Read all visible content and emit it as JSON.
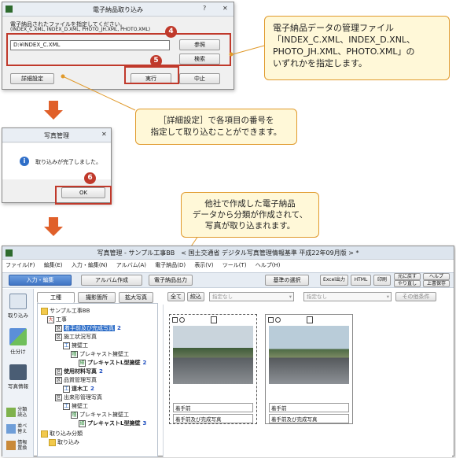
{
  "import_dialog": {
    "title": "電子納品取り込み",
    "instruction_line1": "電子納品されたファイルを指定してください。",
    "instruction_line2": "(INDEX_C.XML, INDEX_D.XML, PHOTO_JH.XML, PHOTO.XML)",
    "path_value": "D:¥INDEX_C.XML",
    "browse_label": "参照",
    "search_label": "検索",
    "detail_label": "詳細設定",
    "run_label": "実行",
    "cancel_label": "中止"
  },
  "callout1": {
    "line1": "電子納品データの管理ファイル",
    "line2": "「INDEX_C.XML、INDEX_D.XNL、",
    "line3": "PHOTO_JH.XML、PHOTO.XML」の",
    "line4": "いずれかを指定します。"
  },
  "callout2": {
    "line1": "［詳細設定］で各項目の番号を",
    "line2": "指定して取り込むことができます。"
  },
  "callout3": {
    "line1": "他社で作成した電子納品",
    "line2": "データから分類が作成されて、",
    "line3": "写真が取り込まれます。"
  },
  "steps": {
    "s4": "4",
    "s5": "5",
    "s6": "6"
  },
  "msg_dialog": {
    "title": "写真管理",
    "message": "取り込みが完了しました。",
    "ok_label": "OK"
  },
  "app": {
    "title": "写真管理 - サンプル工事BB　< 国土交通省 デジタル写真管理情報基準 平成22年09月版 > *",
    "menu": [
      "ファイル(F)",
      "編集(E)",
      "入力・編集(N)",
      "アルバム(A)",
      "電子納品(D)",
      "表示(V)",
      "ツール(T)",
      "ヘルプ(H)"
    ],
    "mode_tabs": [
      "入力・編集",
      "アルバム作成",
      "電子納品出力"
    ],
    "toolbar": {
      "criteria": "基準の選択",
      "excel": "Excel出力",
      "html": "HTML",
      "print": "印刷",
      "undo": "元に戻す",
      "redo": "やり直し",
      "help": "ヘルプ",
      "save": "上書保存"
    },
    "side": {
      "import": "取り込み",
      "sort": "仕分け",
      "photo_info": "写真情報",
      "auto_sort": "分類\n読込",
      "swap": "並べ\n替え",
      "info_swap": "情報\n置換"
    },
    "panel_tabs": [
      "工種",
      "撮影箇所",
      "拡大写真"
    ],
    "filter": {
      "all": "全て",
      "narrow": "絞込",
      "none1": "指定なし",
      "none2": "指定なし",
      "other": "その他条件"
    },
    "tree": {
      "root": "サンプル工事BB",
      "n1": "工事",
      "n2": "着手前及び完成写真",
      "n2c": "2",
      "n3": "施工状況写真",
      "n4": "擁壁工",
      "n5": "プレキャスト擁壁工",
      "n6": "プレキャストL型擁壁",
      "n6c": "2",
      "n7": "使用材料写真",
      "n7c": "2",
      "n8": "品質管理写真",
      "n9": "道木工",
      "n9c": "2",
      "n10": "出来形管理写真",
      "n11": "擁壁工",
      "n12": "プレキャスト擁壁工",
      "n13": "プレキャストL型擁壁",
      "n13c": "3",
      "n14": "取り込み分類",
      "n15": "取り込み"
    },
    "photos": [
      {
        "cap1": "着手前",
        "cap2": "着手前及び完成写真"
      },
      {
        "cap1": "着手前",
        "cap2": "着手前及び完成写真"
      }
    ]
  },
  "colors": {
    "accent": "#c0392b",
    "arrow": "#e0602a",
    "callout_border": "#e09a2c"
  }
}
